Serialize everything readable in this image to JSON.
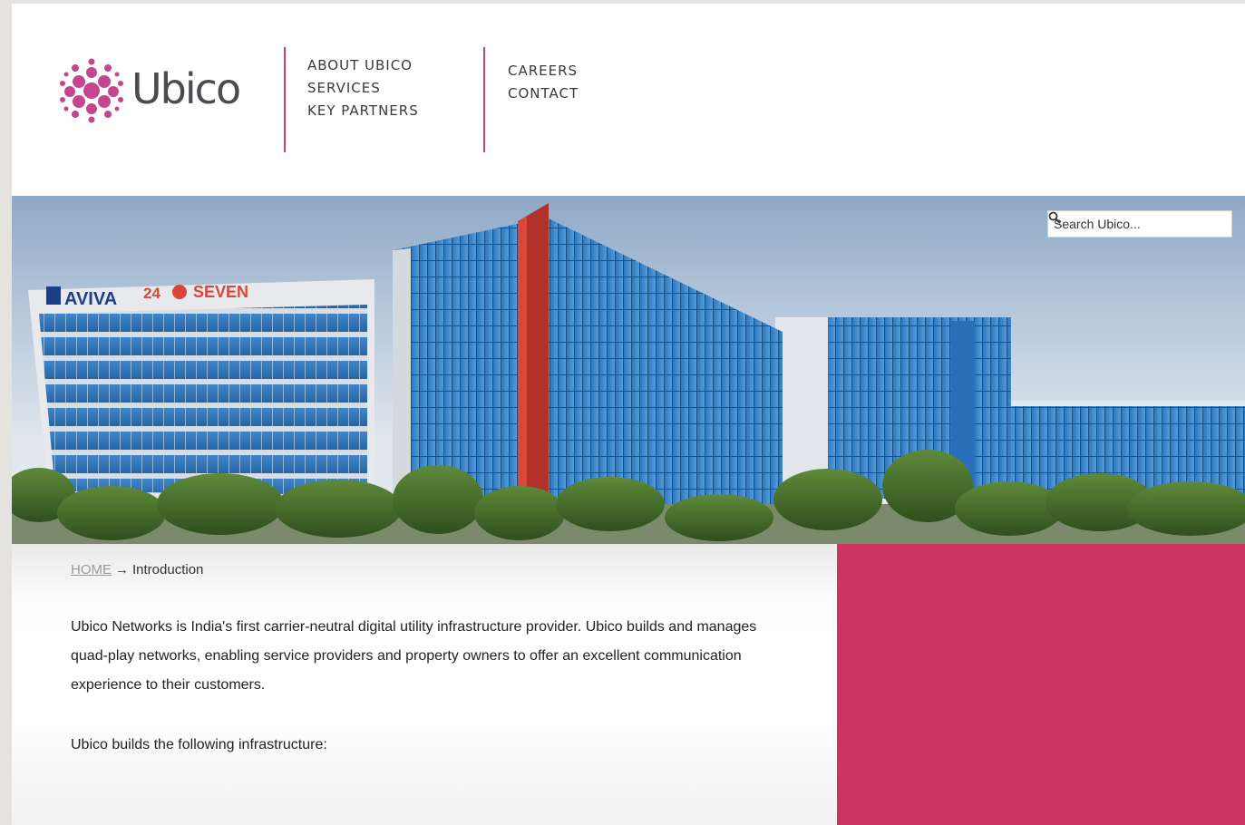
{
  "brand": {
    "name": "Ubico",
    "accent": "#c8406c",
    "panel_color": "#c93560"
  },
  "nav": {
    "group1": [
      "ABOUT UBICO",
      "SERVICES",
      "KEY PARTNERS"
    ],
    "group2": [
      "CAREERS",
      "CONTACT"
    ]
  },
  "hero": {
    "signage": {
      "left": "AVIVA",
      "number": "24",
      "right": "SEVEN"
    }
  },
  "search": {
    "placeholder": "Search Ubico...",
    "icon": "search-icon"
  },
  "breadcrumb": {
    "home": "HOME",
    "separator": "→",
    "current": "Introduction"
  },
  "content": {
    "paragraph1": "Ubico Networks is India's first carrier-neutral digital utility infrastructure provider. Ubico builds and manages quad-play networks, enabling service providers and property owners to offer an excellent communication experience to their customers.",
    "paragraph2": "Ubico builds the following infrastructure:"
  }
}
